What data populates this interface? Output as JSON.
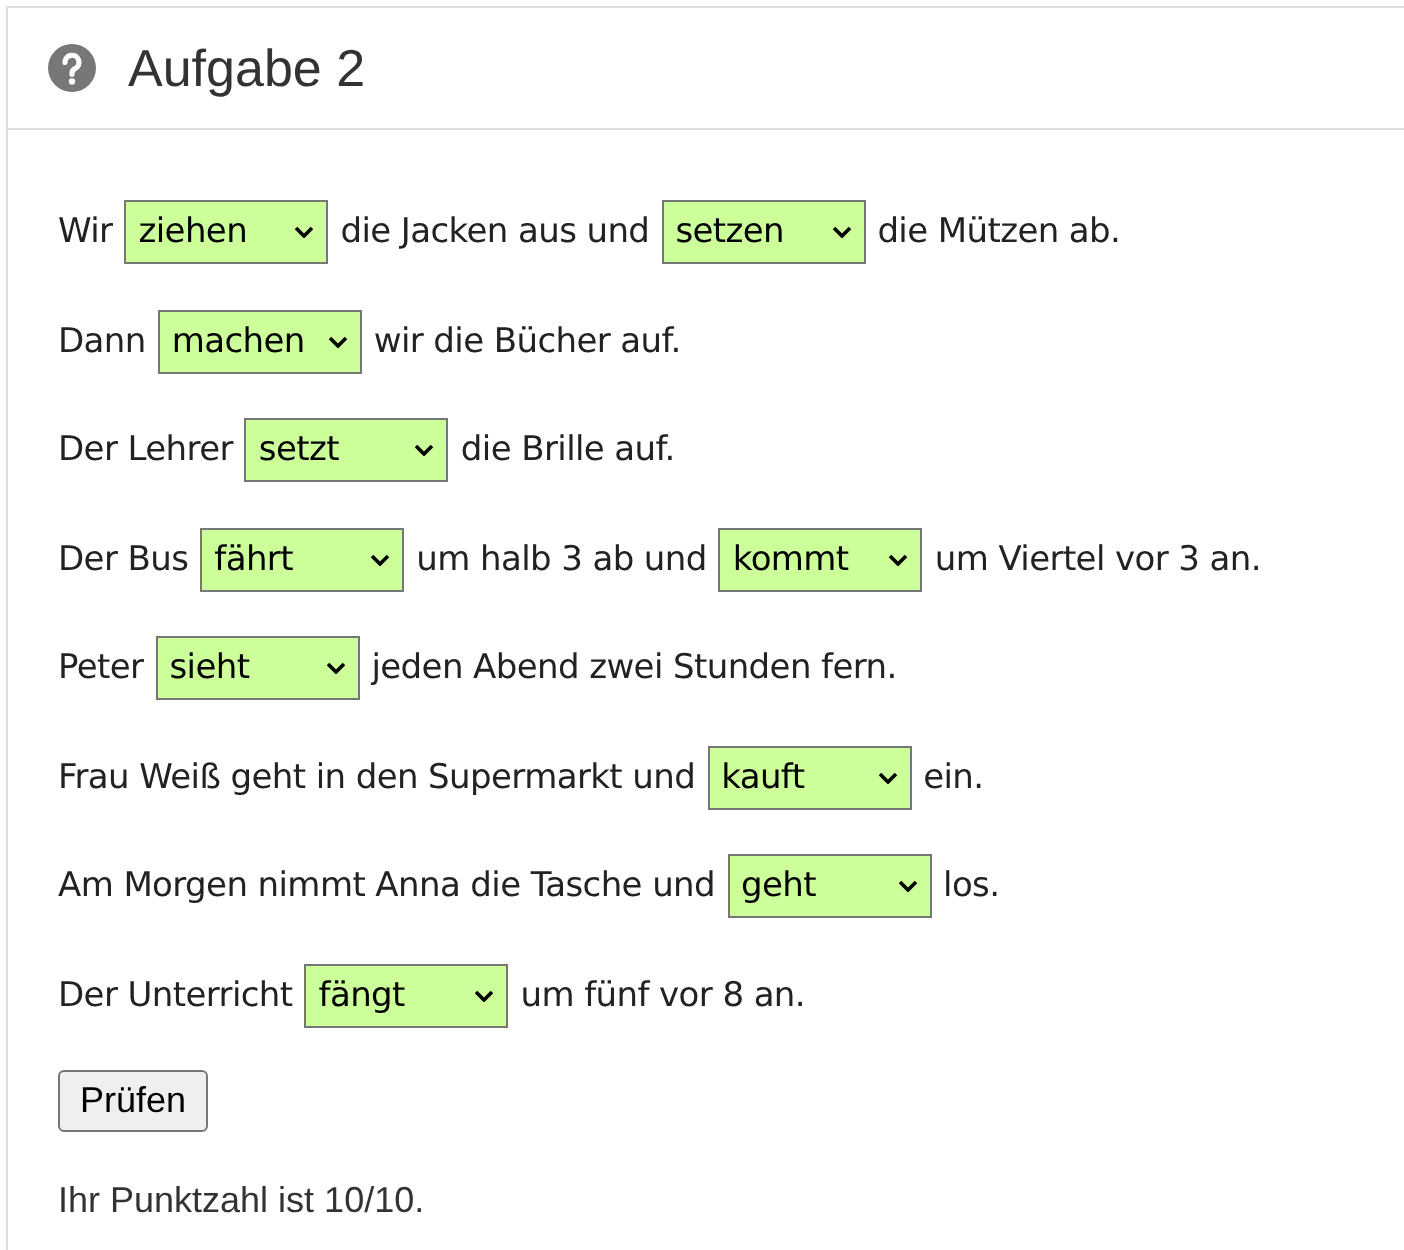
{
  "panel": {
    "title": "Aufgabe 2"
  },
  "sentences": [
    {
      "parts": [
        {
          "kind": "text",
          "text": "Wir"
        },
        {
          "kind": "select",
          "value": "ziehen",
          "correct": true
        },
        {
          "kind": "text",
          "text": "die Jacken aus und"
        },
        {
          "kind": "select",
          "value": "setzen",
          "correct": true
        },
        {
          "kind": "text",
          "text": "die Mützen ab."
        }
      ]
    },
    {
      "parts": [
        {
          "kind": "text",
          "text": "Dann"
        },
        {
          "kind": "select",
          "value": "machen",
          "correct": true
        },
        {
          "kind": "text",
          "text": "wir die Bücher auf."
        }
      ]
    },
    {
      "parts": [
        {
          "kind": "text",
          "text": "Der Lehrer"
        },
        {
          "kind": "select",
          "value": "setzt",
          "correct": true
        },
        {
          "kind": "text",
          "text": "die Brille auf."
        }
      ]
    },
    {
      "parts": [
        {
          "kind": "text",
          "text": "Der Bus"
        },
        {
          "kind": "select",
          "value": "fährt",
          "correct": true
        },
        {
          "kind": "text",
          "text": "um halb 3 ab und"
        },
        {
          "kind": "select",
          "value": "kommt",
          "correct": true
        },
        {
          "kind": "text",
          "text": "um Viertel vor 3 an."
        }
      ]
    },
    {
      "parts": [
        {
          "kind": "text",
          "text": "Peter"
        },
        {
          "kind": "select",
          "value": "sieht",
          "correct": true
        },
        {
          "kind": "text",
          "text": "jeden Abend zwei Stunden fern."
        }
      ]
    },
    {
      "parts": [
        {
          "kind": "text",
          "text": "Frau Weiß geht in den Supermarkt und"
        },
        {
          "kind": "select",
          "value": "kauft",
          "correct": true
        },
        {
          "kind": "text",
          "text": "ein."
        }
      ]
    },
    {
      "parts": [
        {
          "kind": "text",
          "text": "Am Morgen nimmt Anna die Tasche und"
        },
        {
          "kind": "select",
          "value": "geht",
          "correct": true
        },
        {
          "kind": "text",
          "text": "los."
        }
      ]
    },
    {
      "parts": [
        {
          "kind": "text",
          "text": "Der Unterricht"
        },
        {
          "kind": "select",
          "value": "fängt",
          "correct": true
        },
        {
          "kind": "text",
          "text": "um fünf vor 8 an."
        }
      ]
    }
  ],
  "check_button": "Prüfen",
  "score": "Ihr Punktzahl ist 10/10."
}
